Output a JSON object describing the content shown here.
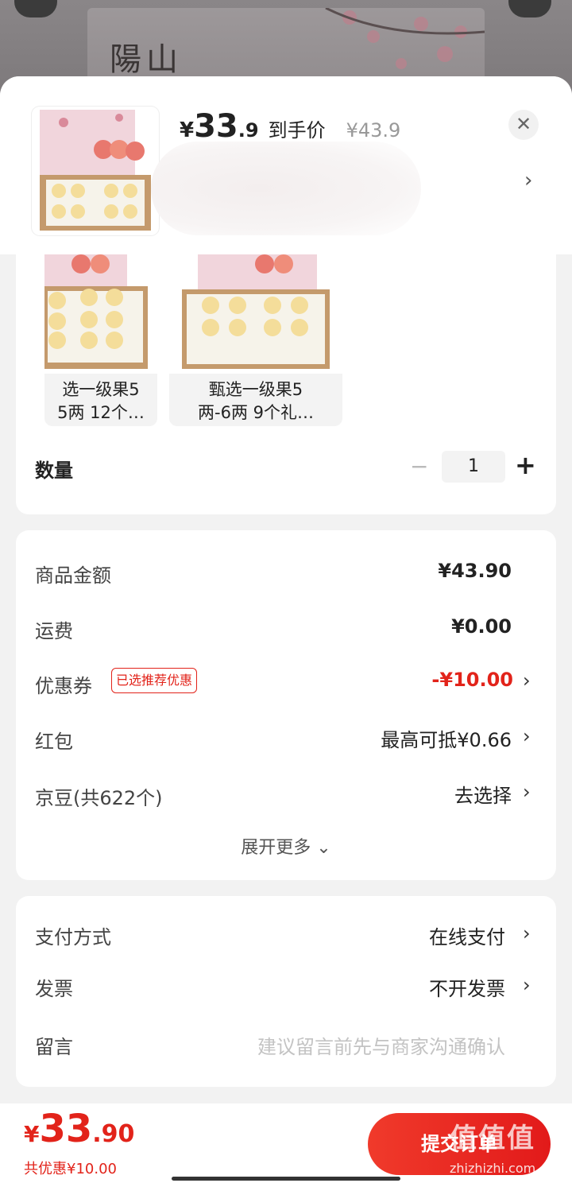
{
  "background": {
    "brand_text": "陽山"
  },
  "header": {
    "yen": "¥",
    "price_int": "33",
    "price_dec": ".9",
    "final_label": "到手价",
    "original_price": "¥43.9",
    "close_icon": "close-icon",
    "chevron": "›"
  },
  "specs": [
    {
      "label": "甄选一级果5两-6两 12个…",
      "line1": "选一级果5",
      "line2": "5两  12个…"
    },
    {
      "label": "甄选一级果5两-6两 9个礼…",
      "line1": "甄选一级果5",
      "line2": "两-6两  9个礼…"
    }
  ],
  "quantity": {
    "label": "数量",
    "minus": "−",
    "value": "1",
    "plus": "+"
  },
  "amounts": {
    "goods_label": "商品金额",
    "goods_value": "¥43.90",
    "shipping_label": "运费",
    "shipping_value": "¥0.00",
    "coupon_label": "优惠券",
    "coupon_tag": "已选推荐优惠",
    "coupon_value": "-¥10.00",
    "redpacket_label": "红包",
    "redpacket_value": "最高可抵¥0.66",
    "jingdou_label": "京豆(共622个)",
    "jingdou_value": "去选择",
    "expand_label": "展开更多 ⌄"
  },
  "payment": {
    "method_label": "支付方式",
    "method_value": "在线支付",
    "invoice_label": "发票",
    "invoice_value": "不开发票",
    "note_label": "留言",
    "note_placeholder": "建议留言前先与商家沟通确认"
  },
  "footer": {
    "yen": "¥",
    "total_int": "33",
    "total_dec": ".90",
    "savings": "共优惠¥10.00",
    "submit_label": "提交订单",
    "watermark": "值值值",
    "watermark_url": "zhizhizhi.com"
  },
  "colors": {
    "accent": "#e2231a",
    "sheet_bg": "#f2f2f2"
  }
}
